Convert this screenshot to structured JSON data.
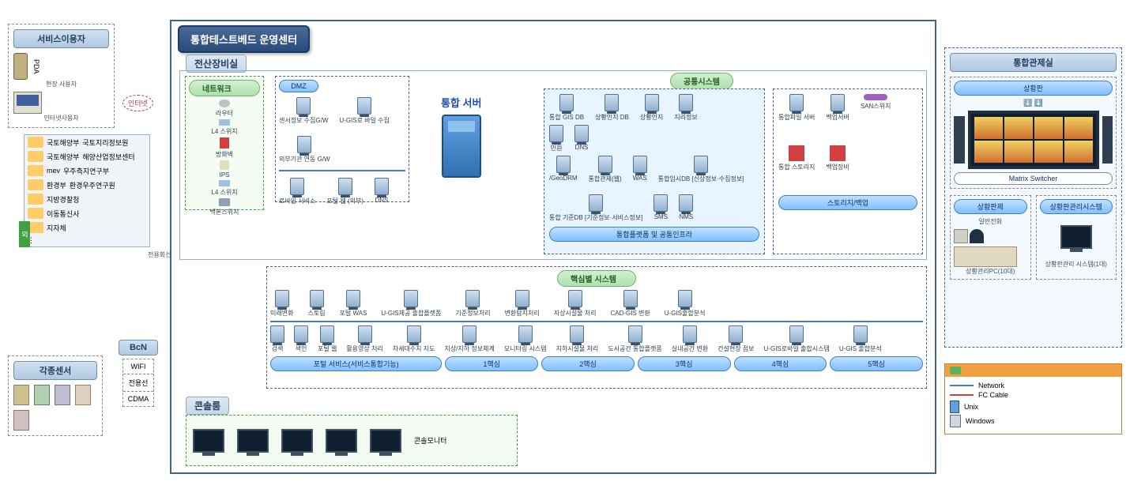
{
  "main_title": "통합테스트베드 운영센터",
  "left": {
    "users_title": "서비스이용자",
    "field_user": "현장 사용자",
    "pda": "PDA",
    "internet_user": "인터넷사용자",
    "cloud": "인터넷",
    "external_side_tab": "외부기관",
    "external": [
      {
        "org": "국토해양부",
        "sys": "국토지리정보원"
      },
      {
        "org": "국토해양부",
        "sys": "해양산업정보센터"
      },
      {
        "org": "mev",
        "sys": "우주측지연구부"
      },
      {
        "org": "환경부",
        "sys": "환경우주연구원"
      },
      {
        "org": "지방경찰청",
        "sys": ""
      },
      {
        "org": "이동통신사",
        "sys": ""
      },
      {
        "org": "지자체",
        "sys": ""
      }
    ],
    "bcn_title": "BcN",
    "bcn_items": [
      "WIFI",
      "전용선",
      "CDMA"
    ],
    "sensor_title": "각종센서",
    "dedicated_line": "전용회선"
  },
  "center": {
    "equip_room": "전산장비실",
    "network_title": "네트워크",
    "network_items": [
      "라우터",
      "L4 스위치",
      "방화벽",
      "IPS",
      "L4 스위치",
      "백본스위치"
    ],
    "dmz_title": "DMZ",
    "dmz_row1": [
      "센서정보 수집G/W",
      "U-GIS로 바일 수집",
      "외부기관 연동 G/W"
    ],
    "dmz_row2": [
      "로바일 서비스",
      "포털 웹 (외부)",
      "DNS"
    ],
    "integrated_server": "통합 서버",
    "common_title": "공통시스템",
    "common_items_r1": [
      "통합 GIS DB",
      "상황인지 DB",
      "상황인지",
      "지리정보"
    ],
    "common_items_r2": [
      "민원",
      "DNS"
    ],
    "common_items_r3": [
      "/GeoDRM",
      "통합관제(웹)",
      "WAS",
      "통합임시DB [신상정보·수집정보]",
      "통합 기준DB [기준정보·서비스정보]",
      "SMS",
      "NMS"
    ],
    "platform_label": "통합플랫폼 및 공통인프라",
    "storage_items": [
      "통합파일 서버",
      "백업서버",
      "SAN스위치",
      "통합 스토리지",
      "백업장비"
    ],
    "storage_label": "스토리지/백업",
    "core_title": "핵심별 시스템",
    "core_row1": [
      "미래변화",
      "스토림",
      "포털 WAS",
      "U-GIS제공 출합플랫폼",
      "기준정보처리",
      "변환탐지처리",
      "지상시설물 처리",
      "CAD-GIS 변환",
      "U-GIS출합분석"
    ],
    "core_row2": [
      "검색",
      "색인",
      "포털 웹",
      "활용영상 처리",
      "차세대수치 지도",
      "지상/지하 정보체계",
      "모니터링 시스템",
      "지하시설물 처리",
      "도시공간 통합플랫폼",
      "실내공간 변환",
      "건설현장 점보",
      "U-GIS로바일 출합시스템",
      "U-GIS 출합분석"
    ],
    "core_groups": [
      "포털 서비스(서비스통합기능)",
      "1핵심",
      "2핵심",
      "3핵심",
      "4핵심",
      "5핵심"
    ],
    "console_title": "콘솔룸",
    "console_label": "콘솔모니터"
  },
  "right": {
    "title": "통합관제실",
    "board_title": "상황판",
    "matrix": "Matrix Switcher",
    "control_title": "상황판제",
    "control_items": [
      "일반전화",
      "상황관리PC(10대)"
    ],
    "mgmt_title": "상황판관리시스템",
    "mgmt_item": "상황판관리 시스템(1대)",
    "legend": {
      "network": "Network",
      "fc": "FC Cable",
      "unix": "Unix",
      "windows": "Windows"
    }
  }
}
